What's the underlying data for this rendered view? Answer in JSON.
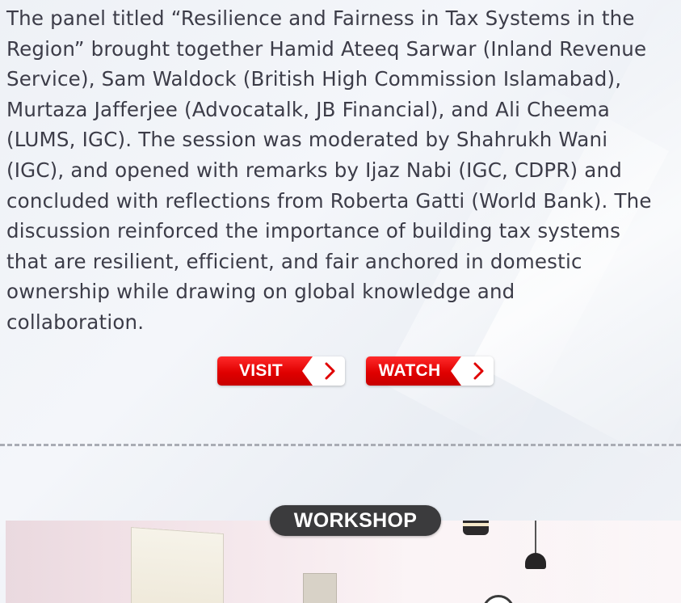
{
  "article": {
    "lines": [
      "The panel titled “Resilience and Fairness in Tax Systems in the",
      "Region” brought together Hamid Ateeq Sarwar (Inland Revenue",
      "Service), Sam Waldock (British High Commission Islamabad),",
      "Murtaza Jafferjee (Advocatalk, JB Financial), and Ali Cheema",
      "(LUMS, IGC). The session was moderated by Shahrukh Wani",
      "(IGC), and opened with remarks by Ijaz Nabi (IGC, CDPR) and",
      "concluded with reflections from Roberta Gatti (World Bank). The",
      "discussion reinforced the importance of building tax systems",
      "that are resilient, efficient, and fair anchored in domestic",
      "ownership while drawing on global knowledge and",
      "collaboration."
    ]
  },
  "buttons": {
    "visit_label": "VISIT",
    "watch_label": "WATCH",
    "chevron_icon": "chevron-right-icon",
    "accent_color": "#e00000"
  },
  "section": {
    "badge_label": "WORKSHOP"
  }
}
